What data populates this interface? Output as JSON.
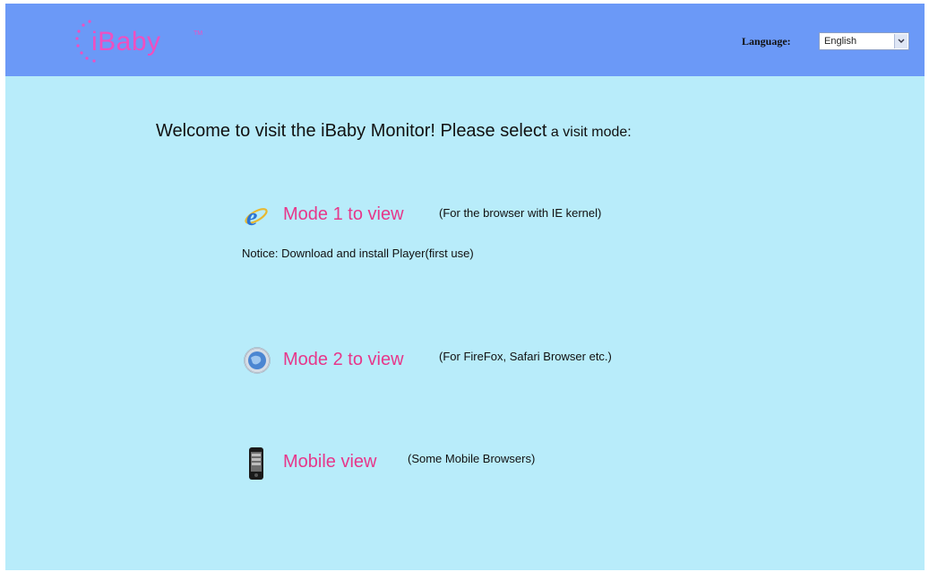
{
  "header": {
    "logo_text": "iBaby",
    "logo_tm": "TM",
    "language_label": "Language:",
    "language_value": "English"
  },
  "main": {
    "welcome_main": "Welcome to visit the iBaby Monitor! Please select",
    "welcome_tail": " a visit mode:",
    "modes": [
      {
        "label": "Mode 1 to view",
        "desc": "(For the browser with IE kernel)",
        "icon": "ie-browser-icon"
      },
      {
        "label": "Mode 2 to view",
        "desc": "(For FireFox, Safari Browser etc.)",
        "icon": "globe-browser-icon"
      },
      {
        "label": "Mobile view",
        "desc": "(Some Mobile Browsers)",
        "icon": "mobile-phone-icon"
      }
    ],
    "notice": "Notice: Download and install Player(first use)"
  },
  "colors": {
    "header_bg": "#6b99f7",
    "page_bg": "#b8ecfa",
    "accent_pink": "#e7378a"
  }
}
